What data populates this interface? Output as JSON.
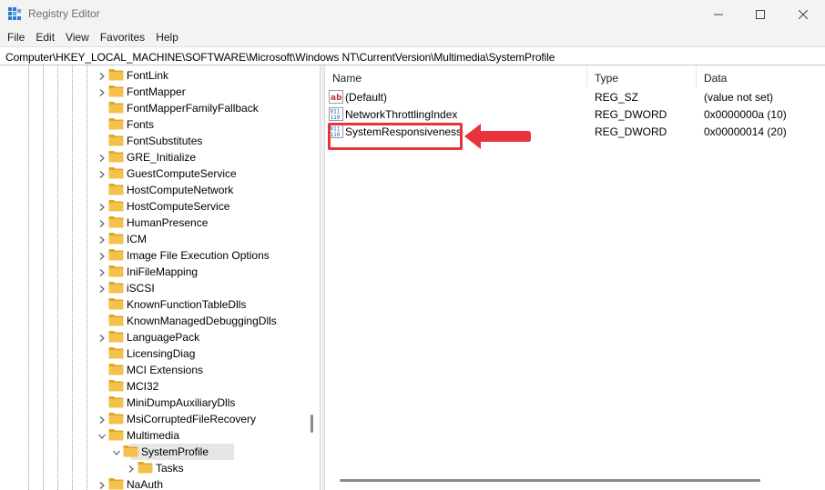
{
  "window": {
    "title": "Registry Editor",
    "icon": "registry-editor-icon"
  },
  "menu": [
    "File",
    "Edit",
    "View",
    "Favorites",
    "Help"
  ],
  "address": "Computer\\HKEY_LOCAL_MACHINE\\SOFTWARE\\Microsoft\\Windows NT\\CurrentVersion\\Multimedia\\SystemProfile",
  "tree": {
    "items": [
      {
        "label": "FontLink",
        "expandable": true
      },
      {
        "label": "FontMapper",
        "expandable": true
      },
      {
        "label": "FontMapperFamilyFallback",
        "expandable": false
      },
      {
        "label": "Fonts",
        "expandable": false
      },
      {
        "label": "FontSubstitutes",
        "expandable": false
      },
      {
        "label": "GRE_Initialize",
        "expandable": true
      },
      {
        "label": "GuestComputeService",
        "expandable": true
      },
      {
        "label": "HostComputeNetwork",
        "expandable": false
      },
      {
        "label": "HostComputeService",
        "expandable": true
      },
      {
        "label": "HumanPresence",
        "expandable": true
      },
      {
        "label": "ICM",
        "expandable": true
      },
      {
        "label": "Image File Execution Options",
        "expandable": true
      },
      {
        "label": "IniFileMapping",
        "expandable": true
      },
      {
        "label": "iSCSI",
        "expandable": true
      },
      {
        "label": "KnownFunctionTableDlls",
        "expandable": false
      },
      {
        "label": "KnownManagedDebuggingDlls",
        "expandable": false
      },
      {
        "label": "LanguagePack",
        "expandable": true
      },
      {
        "label": "LicensingDiag",
        "expandable": false
      },
      {
        "label": "MCI Extensions",
        "expandable": false
      },
      {
        "label": "MCI32",
        "expandable": false
      },
      {
        "label": "MiniDumpAuxiliaryDlls",
        "expandable": false
      },
      {
        "label": "MsiCorruptedFileRecovery",
        "expandable": true
      },
      {
        "label": "Multimedia",
        "expandable": true,
        "expanded": true
      },
      {
        "label": "SystemProfile",
        "expandable": true,
        "expanded": true,
        "selected": true,
        "depth": 1
      },
      {
        "label": "Tasks",
        "expandable": true,
        "depth": 2
      },
      {
        "label": "NaAuth",
        "expandable": true
      }
    ]
  },
  "list": {
    "columns": {
      "name": "Name",
      "type": "Type",
      "data": "Data"
    },
    "rows": [
      {
        "icon": "string-value-icon",
        "name": "(Default)",
        "type": "REG_SZ",
        "data": "(value not set)"
      },
      {
        "icon": "dword-value-icon",
        "name": "NetworkThrottlingIndex",
        "type": "REG_DWORD",
        "data": "0x0000000a (10)"
      },
      {
        "icon": "dword-value-icon",
        "name": "SystemResponsiveness",
        "type": "REG_DWORD",
        "data": "0x00000014 (20)"
      }
    ]
  },
  "annotation": {
    "color": "#e8323c"
  },
  "colors": {
    "folder": "#f5c14b",
    "folder_dark": "#e0a526",
    "selection": "#e6e6e6",
    "chrome": "#f3f3f3"
  }
}
